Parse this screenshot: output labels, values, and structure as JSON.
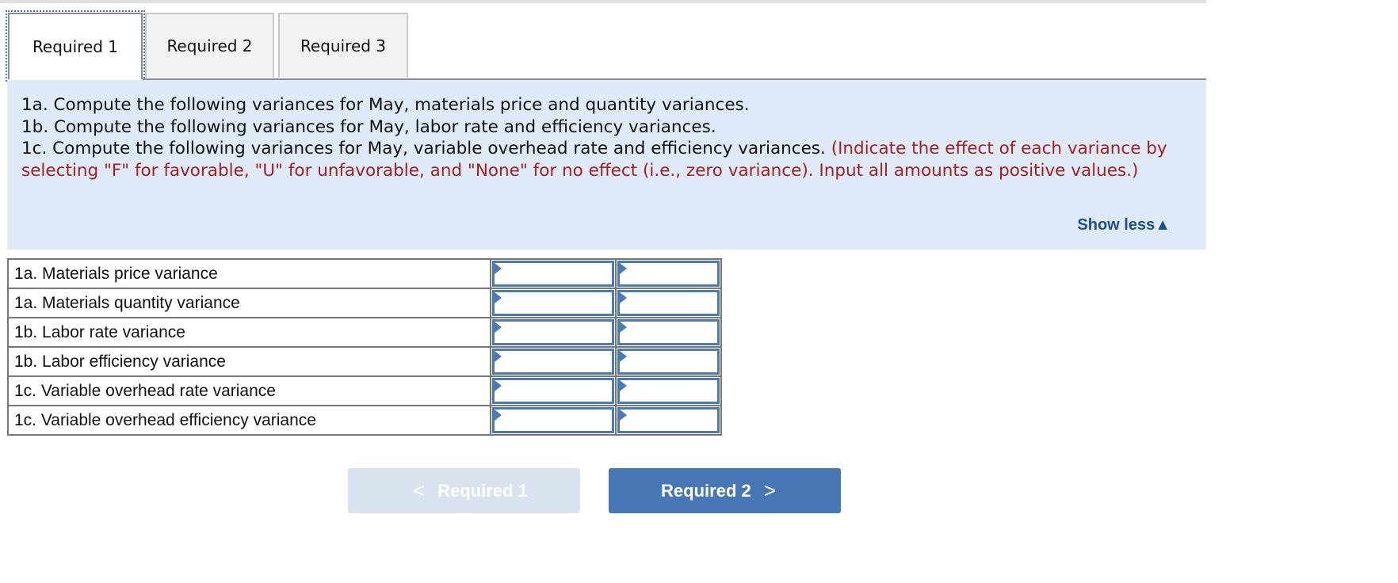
{
  "tabs": [
    {
      "label": "Required 1",
      "active": true
    },
    {
      "label": "Required 2",
      "active": false
    },
    {
      "label": "Required 3",
      "active": false
    }
  ],
  "instructions": {
    "line_1a": "1a. Compute the following variances for May, materials price and quantity variances.",
    "line_1b": "1b. Compute the following variances for May, labor rate and efficiency variances.",
    "line_1c": "1c. Compute the following variances for May, variable overhead rate and efficiency variances.",
    "note": "(Indicate the effect of each variance by selecting \"F\" for favorable, \"U\" for unfavorable, and \"None\" for no effect (i.e., zero variance). Input all amounts as positive values.)",
    "toggle_label": "Show less",
    "toggle_icon": "triangle-up-icon"
  },
  "table": {
    "rows": [
      {
        "label": "1a. Materials price variance",
        "amount": "",
        "effect": ""
      },
      {
        "label": "1a. Materials quantity variance",
        "amount": "",
        "effect": ""
      },
      {
        "label": "1b. Labor rate variance",
        "amount": "",
        "effect": ""
      },
      {
        "label": "1b. Labor efficiency variance",
        "amount": "",
        "effect": ""
      },
      {
        "label": "1c. Variable overhead rate variance",
        "amount": "",
        "effect": ""
      },
      {
        "label": "1c. Variable overhead efficiency variance",
        "amount": "",
        "effect": ""
      }
    ]
  },
  "nav": {
    "prev_label": "Required 1",
    "prev_icon": "chevron-left-icon",
    "prev_enabled": false,
    "next_label": "Required 2",
    "next_icon": "chevron-right-icon",
    "next_enabled": true
  },
  "colors": {
    "accent": "#4777b4",
    "instruction_bg": "#deeaf7",
    "note_red": "#a5201c",
    "link_blue": "#1f4e8c"
  }
}
